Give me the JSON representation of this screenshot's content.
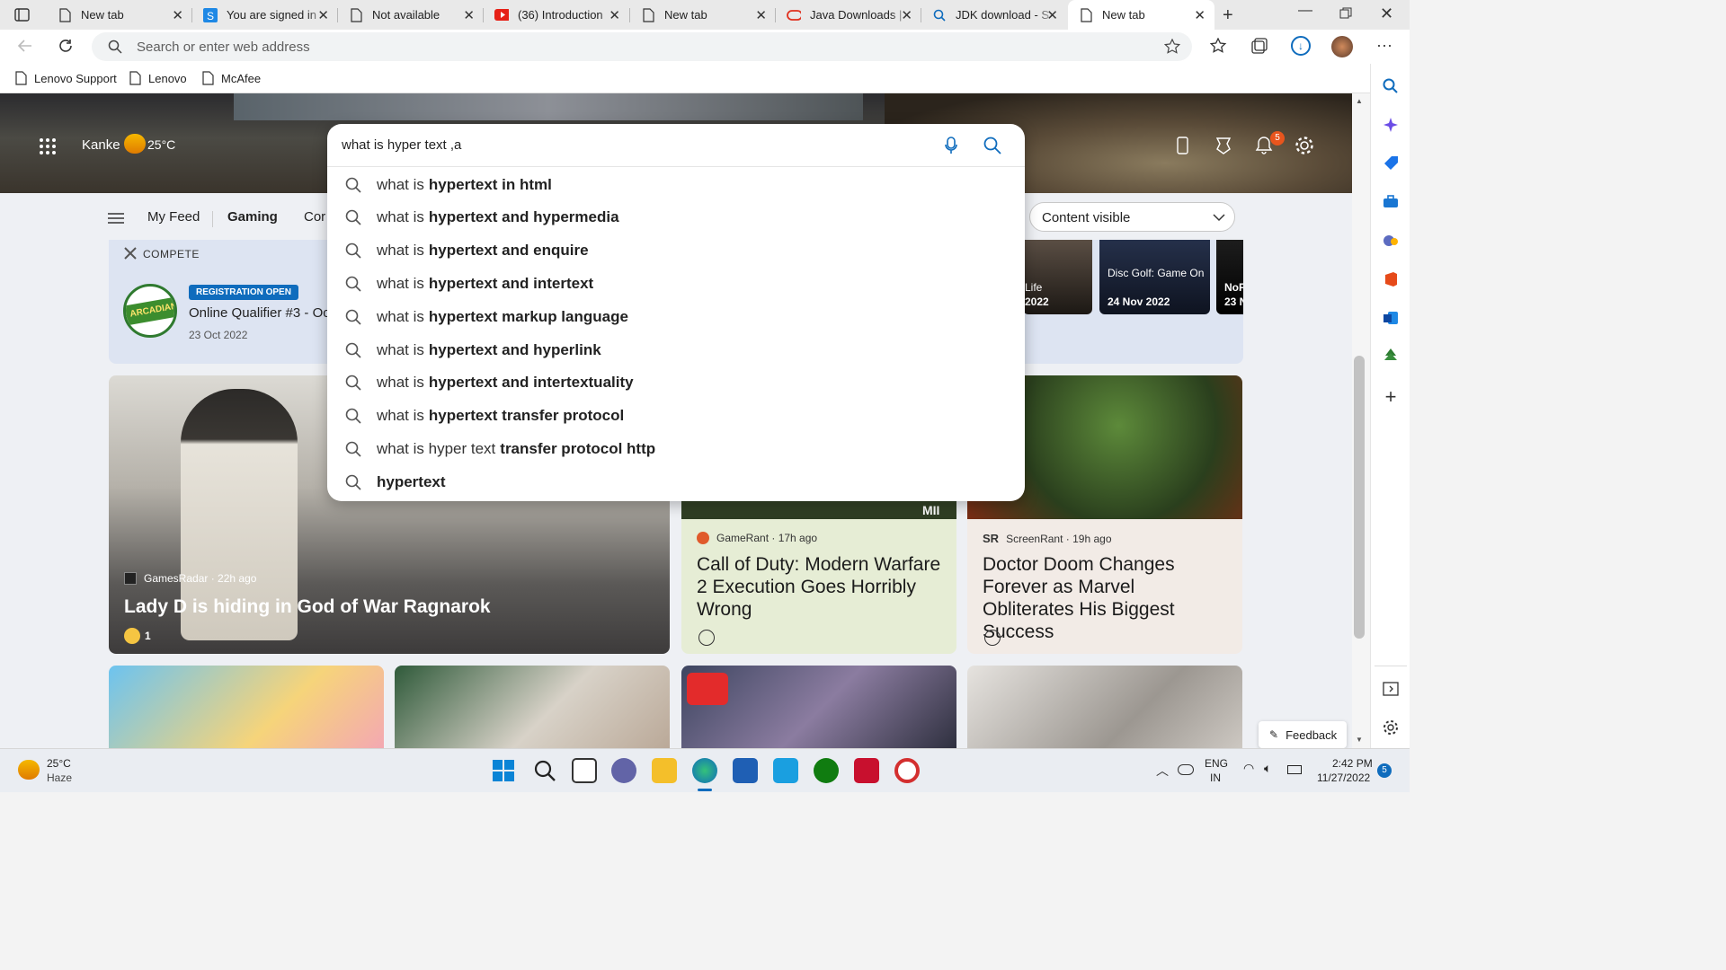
{
  "tabs": [
    {
      "title": "New tab",
      "icon": "page-icon"
    },
    {
      "title": "You are signed in",
      "icon": "s-app-icon"
    },
    {
      "title": "Not available",
      "icon": "page-icon"
    },
    {
      "title": "(36) Introduction",
      "icon": "youtube-icon"
    },
    {
      "title": "New tab",
      "icon": "page-icon"
    },
    {
      "title": "Java Downloads |",
      "icon": "oracle-icon"
    },
    {
      "title": "JDK download - S",
      "icon": "search-icon"
    },
    {
      "title": "New tab",
      "icon": "page-icon",
      "active": true
    }
  ],
  "address_bar": {
    "placeholder": "Search or enter web address"
  },
  "bookmarks": [
    "Lenovo Support",
    "Lenovo",
    "McAfee"
  ],
  "weather": {
    "location": "Kanke",
    "temp": "25°C"
  },
  "notifications": {
    "count": "5"
  },
  "search": {
    "query": "what is hyper text ,a"
  },
  "suggestions": [
    {
      "prefix": "what is",
      "bold": "hypertext in html"
    },
    {
      "prefix": "what is",
      "bold": "hypertext and hypermedia"
    },
    {
      "prefix": "what is",
      "bold": "hypertext and enquire"
    },
    {
      "prefix": "what is",
      "bold": "hypertext and intertext"
    },
    {
      "prefix": "what is",
      "bold": "hypertext markup language"
    },
    {
      "prefix": "what is",
      "bold": "hypertext and hyperlink"
    },
    {
      "prefix": "what is",
      "bold": "hypertext and intertextuality"
    },
    {
      "prefix": "what is",
      "bold": "hypertext transfer protocol"
    },
    {
      "prefix": "what is hyper text",
      "bold": "transfer protocol http"
    },
    {
      "prefix": "",
      "bold": "hypertext"
    }
  ],
  "subnav": {
    "items": [
      "My Feed",
      "Gaming",
      "Cor"
    ],
    "active": "Gaming",
    "content_select": "Content visible"
  },
  "compete": {
    "label": "COMPETE",
    "badge": "REGISTRATION OPEN",
    "title": "Online Qualifier #3 - Oc",
    "date": "23 Oct 2022",
    "logo_text": "ARCADIAN"
  },
  "event_cards": [
    {
      "title": "Life",
      "date": "2022"
    },
    {
      "title": "Disc Golf: Game On",
      "date": "24 Nov 2022"
    },
    {
      "title": "NoF",
      "date": "23 N"
    }
  ],
  "cards": [
    {
      "source": "GamesRadar",
      "time": "22h ago",
      "headline": "Lady D is hiding in God of War Ragnarok",
      "reactions": "1"
    },
    {
      "source": "GameRant",
      "time": "17h ago",
      "headline": "Call of Duty: Modern Warfare 2 Execution Goes Horribly Wrong",
      "image_tag": "MII"
    },
    {
      "source": "ScreenRant",
      "time": "19h ago",
      "headline": "Doctor Doom Changes Forever as Marvel Obliterates His Biggest Success"
    }
  ],
  "feedback": "Feedback",
  "taskbar": {
    "weather_temp": "25°C",
    "weather_desc": "Haze",
    "lang1": "ENG",
    "lang2": "IN",
    "time": "2:42 PM",
    "date": "11/27/2022",
    "badge": "5"
  },
  "colors": {
    "accent": "#0f6cbd",
    "compete_bg": "#dde4f2",
    "cod_card": "#e6edd5",
    "doom_card": "#f2ebe6"
  }
}
